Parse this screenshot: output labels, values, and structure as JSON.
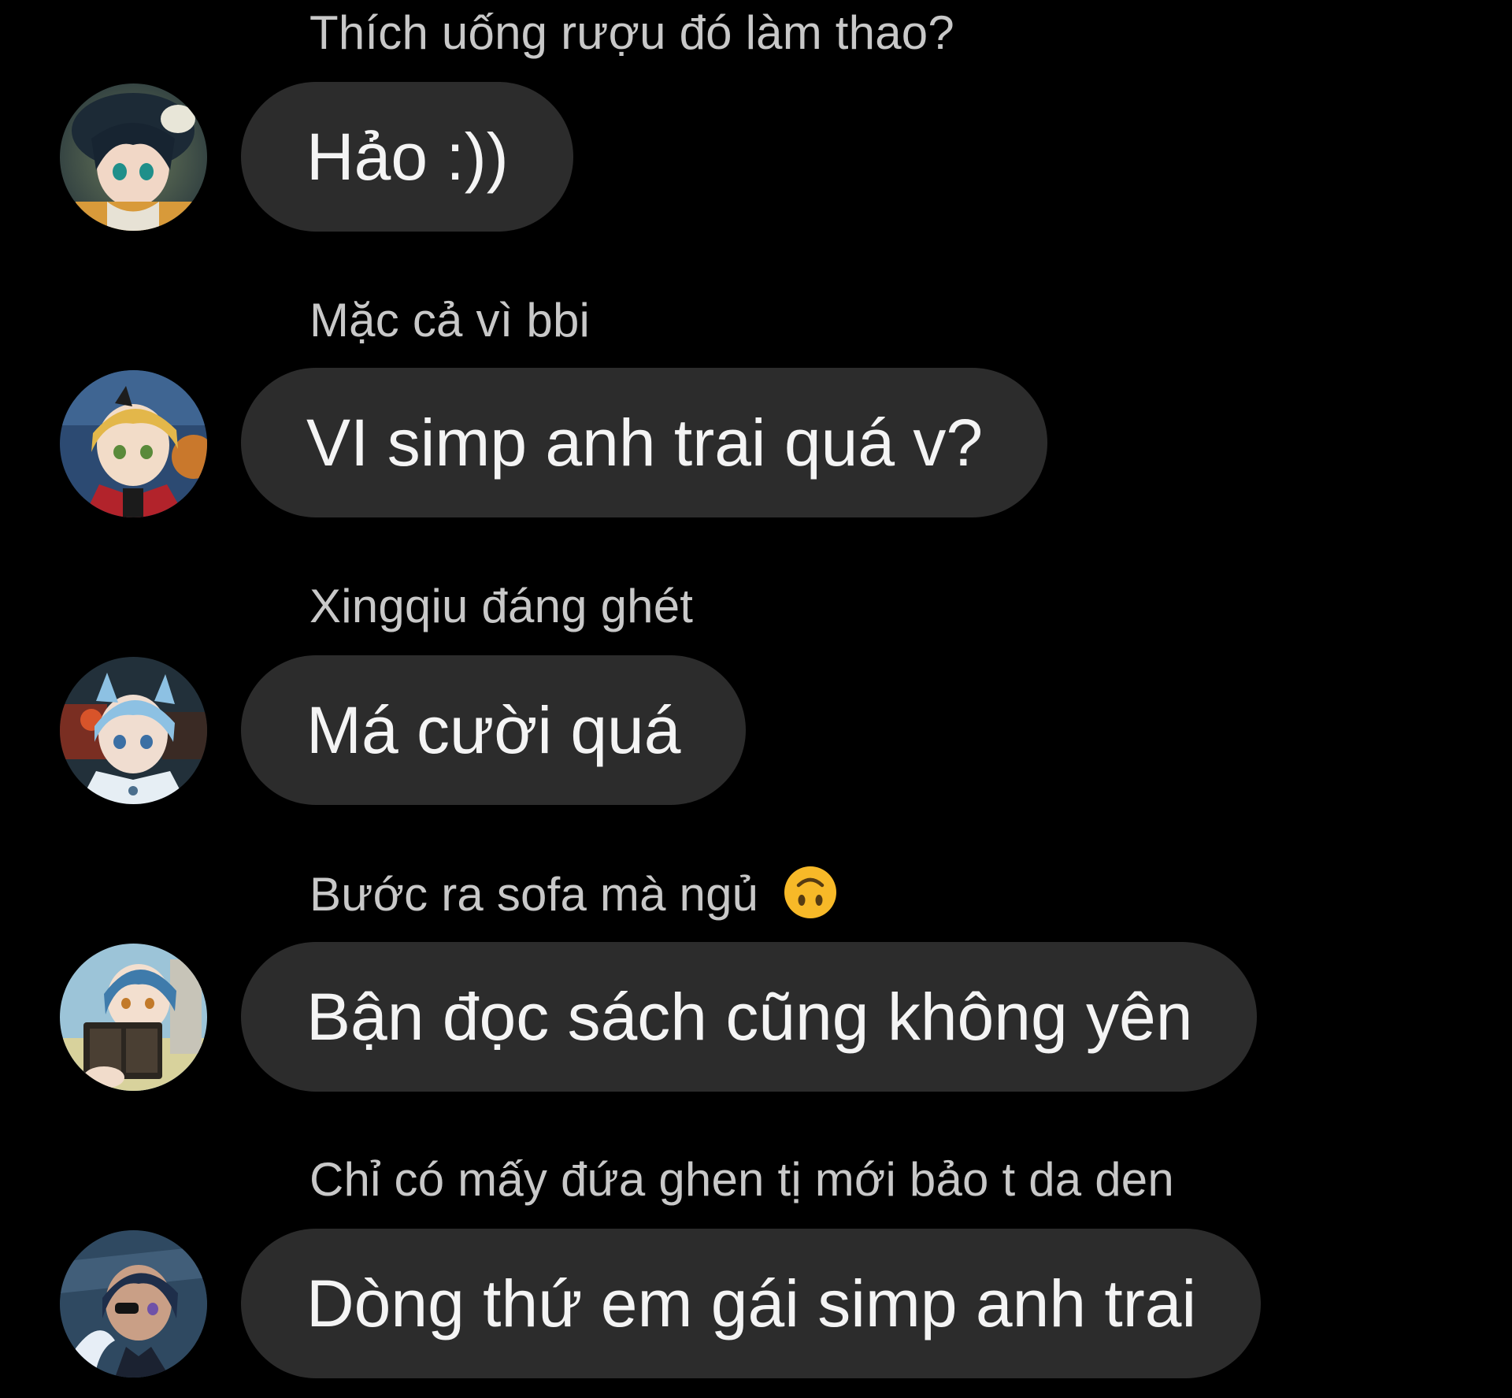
{
  "messages": [
    {
      "status": "Thích uống rượu đó làm thao?",
      "bubble": "Hảo :))",
      "avatar_icon": "venti-avatar"
    },
    {
      "status": "Mặc cả vì bbi",
      "bubble": "VI simp anh trai quá v?",
      "avatar_icon": "thoma-avatar"
    },
    {
      "status": "Xingqiu đáng ghét",
      "bubble": "Má cười quá",
      "avatar_icon": "chongyun-avatar"
    },
    {
      "status": "Bước ra sofa mà ngủ",
      "status_emoji": "upside-down-face-icon",
      "bubble": "Bận đọc sách cũng không yên",
      "avatar_icon": "xingqiu-avatar"
    },
    {
      "status": "Chỉ có mấy đứa ghen tị mới bảo t da den",
      "bubble": "Dòng thứ em gái simp anh trai",
      "avatar_icon": "kaeya-avatar"
    }
  ],
  "colors": {
    "background": "#000000",
    "bubble": "#2c2c2c",
    "bubble_text": "#f4f4f4",
    "status_text": "#c8c8c8",
    "emoji": "#f7b928"
  }
}
